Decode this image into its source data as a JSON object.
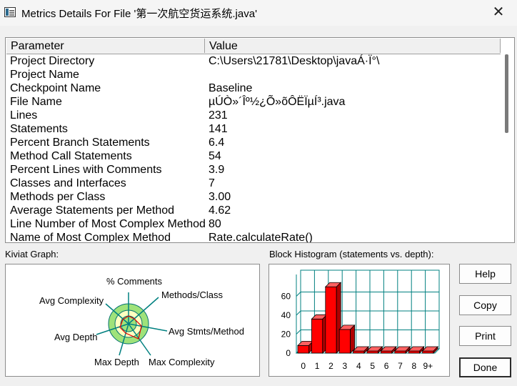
{
  "window": {
    "title": "Metrics Details For File '第一次航空货运系统.java'",
    "close_glyph": "✕",
    "app_icon": "table-icon"
  },
  "table": {
    "headers": [
      "Parameter",
      "Value"
    ],
    "rows": [
      {
        "p": "Project Directory",
        "v": "C:\\Users\\21781\\Desktop\\javaÁ·Ï°\\"
      },
      {
        "p": "Project Name",
        "v": ""
      },
      {
        "p": "Checkpoint Name",
        "v": "Baseline"
      },
      {
        "p": "File Name",
        "v": "µÚÒ»´Îº½¿Õ»õÔËÏµÍ³.java"
      },
      {
        "p": "Lines",
        "v": "231"
      },
      {
        "p": "Statements",
        "v": "141"
      },
      {
        "p": "Percent Branch Statements",
        "v": "6.4"
      },
      {
        "p": "Method Call Statements",
        "v": "54"
      },
      {
        "p": "Percent Lines with Comments",
        "v": "3.9"
      },
      {
        "p": "Classes and Interfaces",
        "v": "7"
      },
      {
        "p": "Methods per Class",
        "v": "3.00"
      },
      {
        "p": "Average Statements per Method",
        "v": "4.62"
      },
      {
        "p": "Line Number of Most Complex Method",
        "v": "80"
      },
      {
        "p": "Name of Most Complex Method",
        "v": "Rate.calculateRate()"
      }
    ]
  },
  "kiviat": {
    "label": "Kiviat Graph:",
    "axes": {
      "comments": "% Comments",
      "methods_class": "Methods/Class",
      "avg_stmts": "Avg Stmts/Method",
      "max_complexity": "Max Complexity",
      "max_depth": "Max Depth",
      "avg_depth": "Avg Depth",
      "avg_complexity": "Avg Complexity"
    },
    "colors": {
      "outer_ring": "#9fe27a",
      "inner_ring": "#ffffc0",
      "axis": "#008080",
      "polygon": "#e00000"
    }
  },
  "histogram": {
    "label": "Block Histogram (statements vs. depth):",
    "colors": {
      "bar": "#ff0000",
      "grid": "#008080"
    }
  },
  "chart_data": {
    "type": "bar",
    "title": "Block Histogram (statements vs. depth):",
    "categories": [
      "0",
      "1",
      "2",
      "3",
      "4",
      "5",
      "6",
      "7",
      "8",
      "9+"
    ],
    "values": [
      8,
      36,
      70,
      25,
      2,
      0,
      0,
      0,
      0,
      0
    ],
    "y_ticks": [
      "0",
      "20",
      "40",
      "60"
    ],
    "ylim": [
      0,
      80
    ],
    "grid": true
  },
  "buttons": {
    "help": "Help",
    "copy": "Copy",
    "print": "Print",
    "done": "Done"
  }
}
